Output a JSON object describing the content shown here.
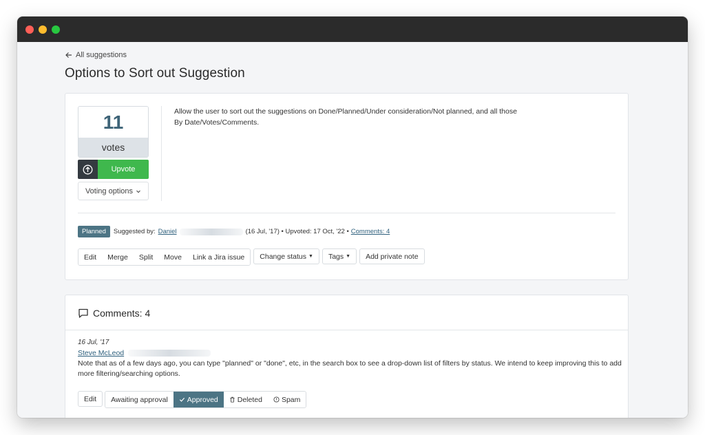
{
  "window": {
    "controls": [
      "close",
      "minimize",
      "zoom"
    ],
    "colors": {
      "close": "#ff5f57",
      "minimize": "#febc2e",
      "zoom": "#28c840",
      "titlebar": "#2b2b2b"
    }
  },
  "nav": {
    "back_label": "All suggestions",
    "back_icon": "arrow-left-icon"
  },
  "page": {
    "title": "Options to Sort out Suggestion"
  },
  "suggestion": {
    "votes_count": "11",
    "votes_label": "votes",
    "upvote_label": "Upvote",
    "upvote_icon": "arrow-up-circle-icon",
    "voting_options_label": "Voting options",
    "description": "Allow the user to sort out the suggestions on Done/Planned/Under consideration/Not planned, and all those By Date/Votes/Comments.",
    "status_badge": "Planned",
    "suggested_by_prefix": "Suggested by:",
    "author": "Daniel",
    "meta_tail": "(16 Jul, '17) • Upvoted: 17 Oct, '22 •",
    "comments_link": "Comments: 4",
    "actions": {
      "edit": "Edit",
      "merge": "Merge",
      "split": "Split",
      "move": "Move",
      "link_jira": "Link a Jira issue",
      "change_status": "Change status",
      "tags": "Tags",
      "private_note": "Add private note"
    }
  },
  "comments": {
    "header": "Comments: 4",
    "header_icon": "speech-bubble-icon",
    "items": [
      {
        "date": "16 Jul, '17",
        "author": "Steve McLeod",
        "text": "Note that as of a few days ago, you can type \"planned\" or \"done\", etc, in the search box to see a drop-down list of filters by status. We intend to keep improving this to add more filtering/searching options.",
        "actions": {
          "edit": "Edit",
          "awaiting": "Awaiting approval",
          "approved": "Approved",
          "deleted": "Deleted",
          "spam": "Spam"
        }
      }
    ]
  },
  "colors": {
    "accent": "#4c7484",
    "upvote_green": "#3fb84d",
    "vote_count": "#3e6478",
    "link": "#2d5f7c"
  }
}
